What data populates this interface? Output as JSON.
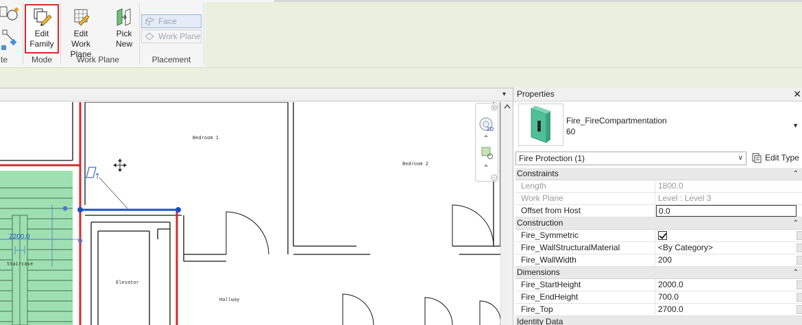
{
  "ribbon": {
    "left_partial_label": "te",
    "edit_family": {
      "line1": "Edit",
      "line2": "Family"
    },
    "edit_work_plane": {
      "line1": "Edit",
      "line2": "Work Plane"
    },
    "pick_new": {
      "line1": "Pick",
      "line2": "New"
    },
    "placement_options": {
      "face": "Face",
      "work_plane": "Work Plane"
    },
    "panels": {
      "mode": "Mode",
      "work_plane": "Work Plane",
      "placement": "Placement"
    }
  },
  "view": {
    "menu_arrow": "▾",
    "rooms": {
      "bedroom1": "Bedroom 1",
      "bedroom2": "Bedroom 2",
      "elevator": "Elevator",
      "hallway": "Hallway",
      "staircase": "Staircase"
    },
    "dimension": "2200.0",
    "nav_2d": "2D"
  },
  "properties": {
    "title": "Properties",
    "close": "✕",
    "type_name": "Fire_FireCompartmentation",
    "type_value": "60",
    "instance_filter": "Fire Protection (1)",
    "edit_type": "Edit Type",
    "groups": [
      {
        "name": "Constraints",
        "rows": [
          {
            "name": "Length",
            "value": "1800.0",
            "readonly": true
          },
          {
            "name": "Work Plane",
            "value": "Level : Level 3",
            "readonly": true
          },
          {
            "name": "Offset from Host",
            "value": "0.0",
            "editing": true
          }
        ]
      },
      {
        "name": "Construction",
        "rows": [
          {
            "name": "Fire_Symmetric",
            "checkbox": true
          },
          {
            "name": "Fire_WallStructuralMaterial",
            "value": "<By Category>"
          },
          {
            "name": "Fire_WallWidth",
            "value": "200"
          }
        ]
      },
      {
        "name": "Dimensions",
        "rows": [
          {
            "name": "Fire_StartHeight",
            "value": "2000.0"
          },
          {
            "name": "Fire_EndHeight",
            "value": "700.0"
          },
          {
            "name": "Fire_Top",
            "value": "2700.0"
          }
        ]
      },
      {
        "name": "Identity Data",
        "rows": []
      }
    ]
  },
  "colors": {
    "accent_red": "#d42a2a",
    "selection_blue": "#1a4fc4",
    "ribbon_green": "#e9f0dd",
    "room_fill": "#9ee0b2"
  }
}
